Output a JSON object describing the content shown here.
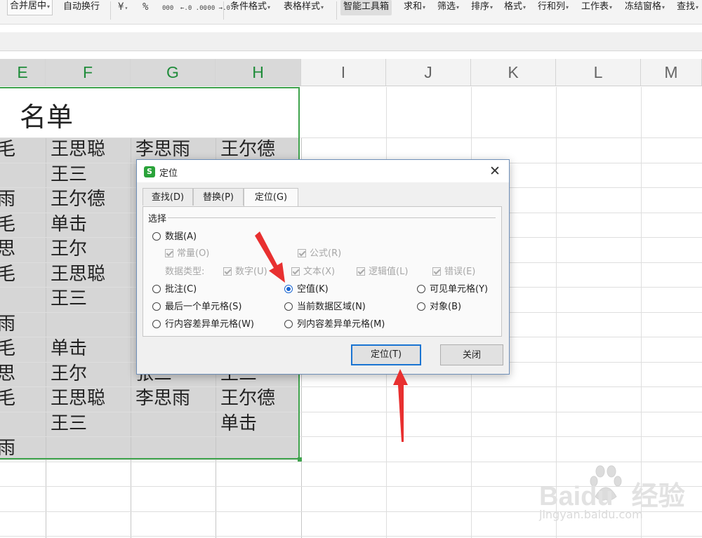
{
  "toolbar": {
    "merge_center": "合并居中",
    "wrap_text": "自动换行",
    "currency_symbol": "¥",
    "percent_symbol": "%",
    "thousands_symbol": "000",
    "inc_decimal_symbol": "←.0 .00",
    "dec_decimal_symbol": ".00 →.0",
    "conditional_format": "条件格式",
    "table_style": "表格样式",
    "smart_toolbox": "智能工具箱",
    "sum": "求和",
    "filter": "筛选",
    "sort": "排序",
    "format": "格式",
    "rows_cols": "行和列",
    "worksheet": "工作表",
    "freeze_panes": "冻结窗格",
    "find": "查找"
  },
  "columns": [
    "E",
    "F",
    "G",
    "H",
    "I",
    "J",
    "K",
    "L",
    "M"
  ],
  "sheet": {
    "title": "名单",
    "rows": [
      [
        "毛",
        "王思聪",
        "李思雨",
        "王尔德"
      ],
      [
        "",
        "王三",
        "",
        ""
      ],
      [
        "雨",
        "王尔德",
        "",
        ""
      ],
      [
        "毛",
        "单击",
        "",
        ""
      ],
      [
        "思",
        "王尔",
        "",
        ""
      ],
      [
        "毛",
        "王思聪",
        "",
        ""
      ],
      [
        "",
        "王三",
        "",
        ""
      ],
      [
        "雨",
        "",
        "",
        ""
      ],
      [
        "毛",
        "单击",
        "",
        ""
      ],
      [
        "思",
        "王尔",
        "张三",
        "王三"
      ],
      [
        "毛",
        "王思聪",
        "李思雨",
        "王尔德"
      ],
      [
        "",
        "王三",
        "",
        "单击"
      ],
      [
        "雨",
        "",
        "",
        ""
      ]
    ]
  },
  "dialog": {
    "title": "定位",
    "app_icon": "S",
    "close_symbol": "✕",
    "tabs": [
      "查找(D)",
      "替换(P)",
      "定位(G)"
    ],
    "active_tab": "定位(G)",
    "group_label": "选择",
    "options": {
      "data": "数据(A)",
      "constant": "常量(O)",
      "formula": "公式(R)",
      "data_type_label": "数据类型:",
      "number": "数字(U)",
      "text": "文本(X)",
      "logical": "逻辑值(L)",
      "error": "错误(E)",
      "comment": "批注(C)",
      "blank": "空值(K)",
      "visible_cells": "可见单元格(Y)",
      "last_cell": "最后一个单元格(S)",
      "current_region": "当前数据区域(N)",
      "objects": "对象(B)",
      "row_diff": "行内容差异单元格(W)",
      "col_diff": "列内容差异单元格(M)"
    },
    "selected_option": "空值(K)",
    "goto_button": "定位(T)",
    "close_button": "关闭"
  },
  "watermark": {
    "brand": "Baidu",
    "brand_cn": "经验",
    "url": "jingyan.baidu.com"
  },
  "colors": {
    "selection_green": "#3fa34d",
    "arrow_red": "#e83030",
    "radio_blue": "#1a66d2",
    "app_icon_green": "#2aa33a"
  }
}
